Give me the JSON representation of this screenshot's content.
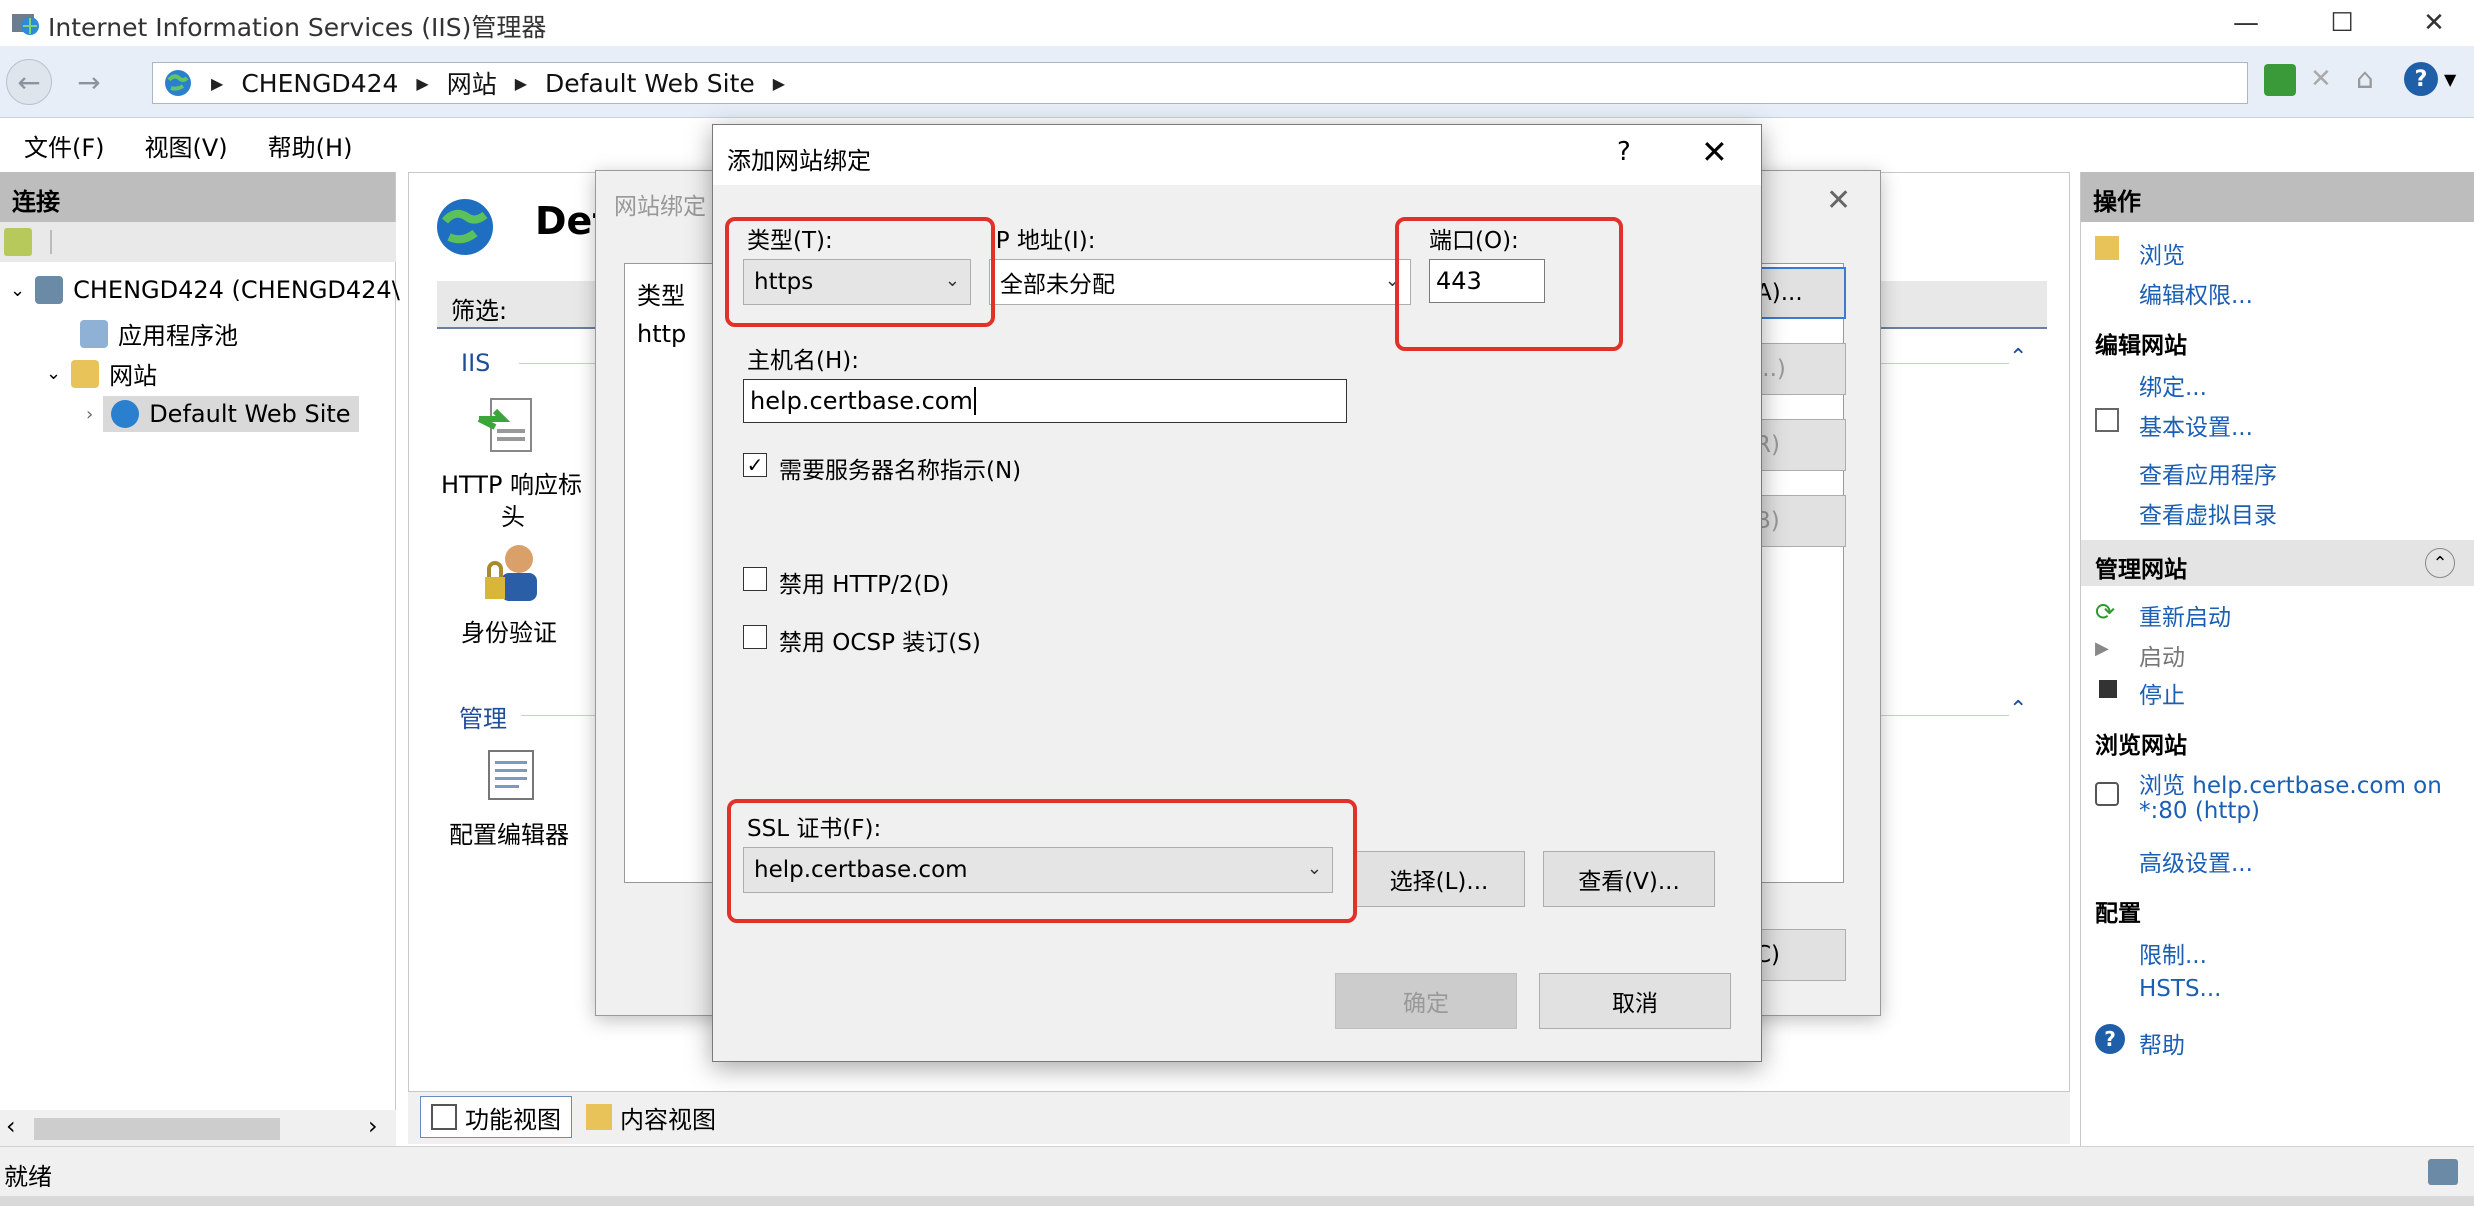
{
  "window": {
    "title": "Internet Information Services (IIS)管理器"
  },
  "address": {
    "crumbs": [
      "CHENGD424",
      "网站",
      "Default Web Site"
    ]
  },
  "menu": [
    "文件(F)",
    "视图(V)",
    "帮助(H)"
  ],
  "left": {
    "title": "连接",
    "tree": {
      "server": "CHENGD424 (CHENGD424\\",
      "apppools": "应用程序池",
      "sites": "网站",
      "site": "Default Web Site"
    }
  },
  "middle": {
    "title": "Def",
    "filter_label": "筛选:",
    "group_iis": "IIS",
    "group_manage": "管理",
    "features": {
      "http_headers": "HTTP 响应标",
      "http_headers_2": "头",
      "auth": "身份验证",
      "config_editor": "配置编辑器"
    },
    "tabs": {
      "features_view": "功能视图",
      "content_view": "内容视图"
    }
  },
  "bg_dialog": {
    "title": "网站绑定",
    "col_type": "类型",
    "row_type": "http",
    "btn_add": "A)...",
    "btn_edit": "...)",
    "btn_remove": "R)",
    "btn_browse": "B)",
    "btn_close": "C)"
  },
  "dialog": {
    "title": "添加网站绑定",
    "help": "?",
    "type_label": "类型(T):",
    "type_value": "https",
    "ip_label": "IP 地址(I):",
    "ip_value": "全部未分配",
    "port_label": "端口(O):",
    "port_value": "443",
    "host_label": "主机名(H):",
    "host_value": "help.certbase.com",
    "sni_label": "需要服务器名称指示(N)",
    "sni_checked": true,
    "http2_label": "禁用 HTTP/2(D)",
    "ocsp_label": "禁用 OCSP 装订(S)",
    "ssl_label": "SSL 证书(F):",
    "ssl_value": "help.certbase.com",
    "select_btn": "选择(L)...",
    "view_btn": "查看(V)...",
    "ok_btn": "确定",
    "cancel_btn": "取消"
  },
  "actions": {
    "title": "操作",
    "browse": "浏览",
    "edit_perms": "编辑权限...",
    "edit_site": "编辑网站",
    "bindings": "绑定...",
    "basic_settings": "基本设置...",
    "view_apps": "查看应用程序",
    "view_vdirs": "查看虚拟目录",
    "manage_site": "管理网站",
    "restart": "重新启动",
    "start": "启动",
    "stop": "停止",
    "browse_site": "浏览网站",
    "browse_link_1": "浏览 help.certbase.com on",
    "browse_link_2": "*:80 (http)",
    "advanced": "高级设置...",
    "config": "配置",
    "limits": "限制...",
    "hsts": "HSTS...",
    "help": "帮助"
  },
  "status": {
    "text": "就绪"
  },
  "colors": {
    "accent_red": "#e0322b",
    "link": "#1a5fb4"
  }
}
